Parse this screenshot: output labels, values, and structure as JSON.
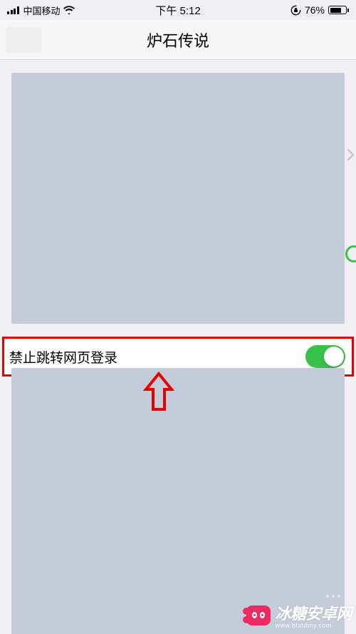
{
  "statusBar": {
    "carrier": "中国移动",
    "time": "下午 5:12",
    "batteryPct": "76%"
  },
  "nav": {
    "title": "炉石传说"
  },
  "setting": {
    "disableWebLoginLabel": "禁止跳转网页登录",
    "disableWebLoginOn": true
  },
  "watermark": {
    "brand": "冰糖安卓网",
    "domain": "www.btxtdmy.com"
  },
  "colors": {
    "accentGreen": "#39c24a",
    "highlightRed": "#e60000",
    "watermarkPink": "#ef2a63",
    "placeholderGrey": "#c4ccd9"
  }
}
